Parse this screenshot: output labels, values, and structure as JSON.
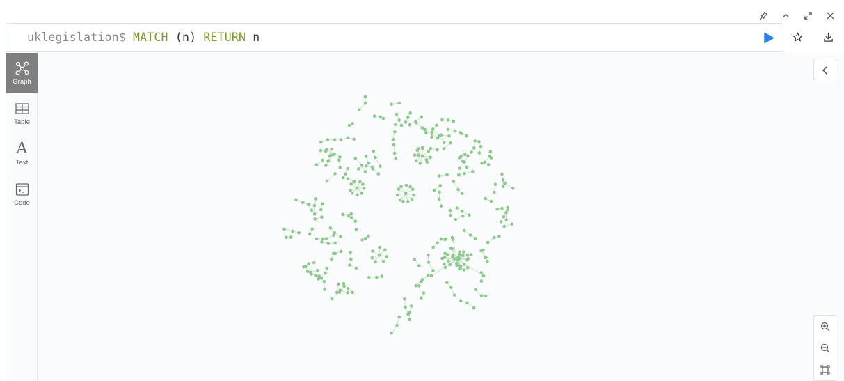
{
  "editor": {
    "prompt": "uklegislation$",
    "query_tokens": [
      {
        "text": "MATCH",
        "kind": "keyword"
      },
      {
        "text": " (n) ",
        "kind": "plain"
      },
      {
        "text": "RETURN",
        "kind": "keyword"
      },
      {
        "text": " n",
        "kind": "plain"
      }
    ]
  },
  "window_controls": [
    "pin-icon",
    "chevron-up-icon",
    "expand-icon",
    "close-icon"
  ],
  "editor_actions": [
    "run-icon",
    "star-icon",
    "download-icon"
  ],
  "sidebar": {
    "tabs": [
      {
        "label": "Graph",
        "icon": "graph-icon",
        "active": true
      },
      {
        "label": "Table",
        "icon": "table-icon",
        "active": false
      },
      {
        "label": "Text",
        "icon": "text-icon",
        "active": false
      },
      {
        "label": "Code",
        "icon": "code-icon",
        "active": false
      }
    ]
  },
  "graph": {
    "node_color": "#8dc98a",
    "edge_color": "#c5dcc4"
  },
  "colors": {
    "keyword": "#7a9a2a",
    "run": "#2f80ed",
    "active_tab": "#7f7f7f"
  }
}
